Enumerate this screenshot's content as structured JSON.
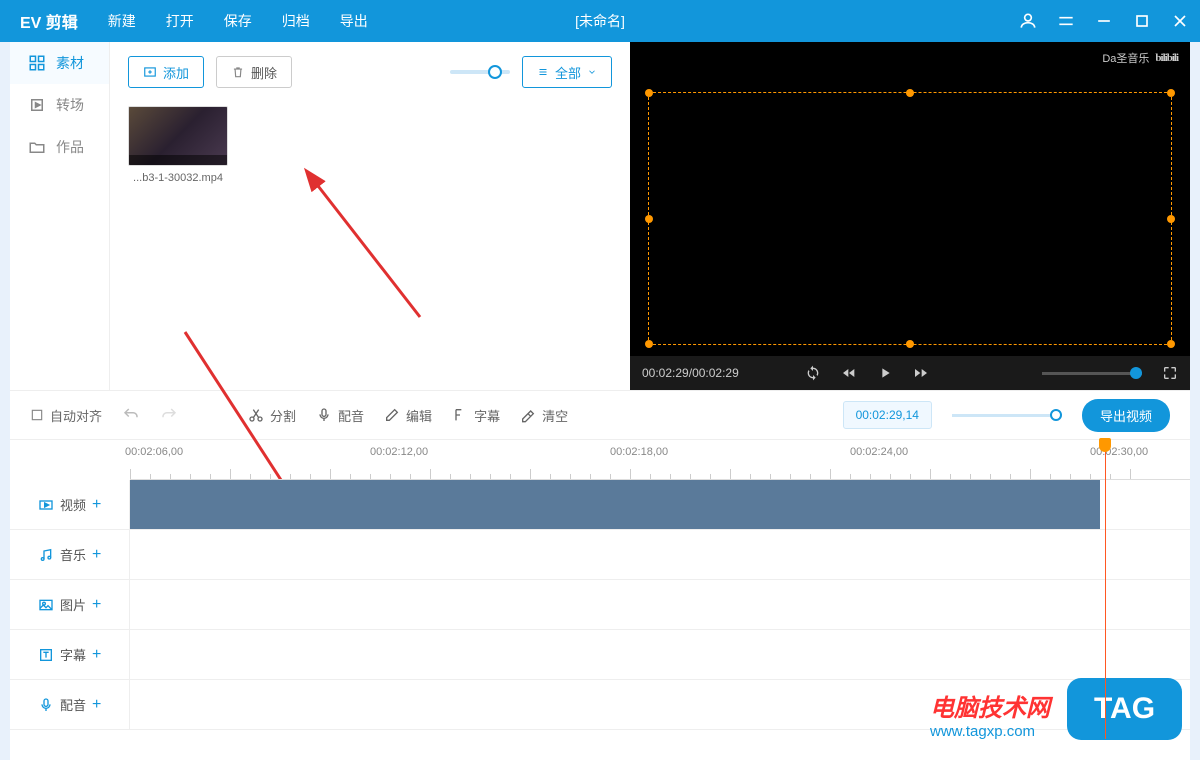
{
  "app": {
    "name": "EV 剪辑"
  },
  "menu": [
    "新建",
    "打开",
    "保存",
    "归档",
    "导出"
  ],
  "doc": {
    "title": "[未命名]"
  },
  "left_tabs": {
    "items": [
      {
        "label": "素材",
        "icon": "grid-icon"
      },
      {
        "label": "转场",
        "icon": "square-icon"
      },
      {
        "label": "作品",
        "icon": "folder-icon"
      }
    ]
  },
  "asset_toolbar": {
    "add": "添加",
    "delete": "删除",
    "filter": "全部"
  },
  "assets": [
    {
      "name": "...b3-1-30032.mp4"
    }
  ],
  "preview": {
    "watermark_left": "Da圣音乐",
    "watermark_right": "bilibili",
    "time_current": "00:02:29",
    "time_total": "00:02:29"
  },
  "toolbar": {
    "autosnap": "自动对齐",
    "split": "分割",
    "dub": "配音",
    "edit": "编辑",
    "subtitle": "字幕",
    "clear": "清空",
    "timecode": "00:02:29,14",
    "export": "导出视频"
  },
  "ruler": [
    "00:02:06,00",
    "00:02:12,00",
    "00:02:18,00",
    "00:02:24,00",
    "00:02:30,00"
  ],
  "tracks": {
    "video": "视频",
    "music": "音乐",
    "image": "图片",
    "subtitle": "字幕",
    "dub": "配音"
  },
  "watermark": {
    "line1": "电脑技术网",
    "line2": "www.tagxp.com",
    "badge": "TAG"
  }
}
